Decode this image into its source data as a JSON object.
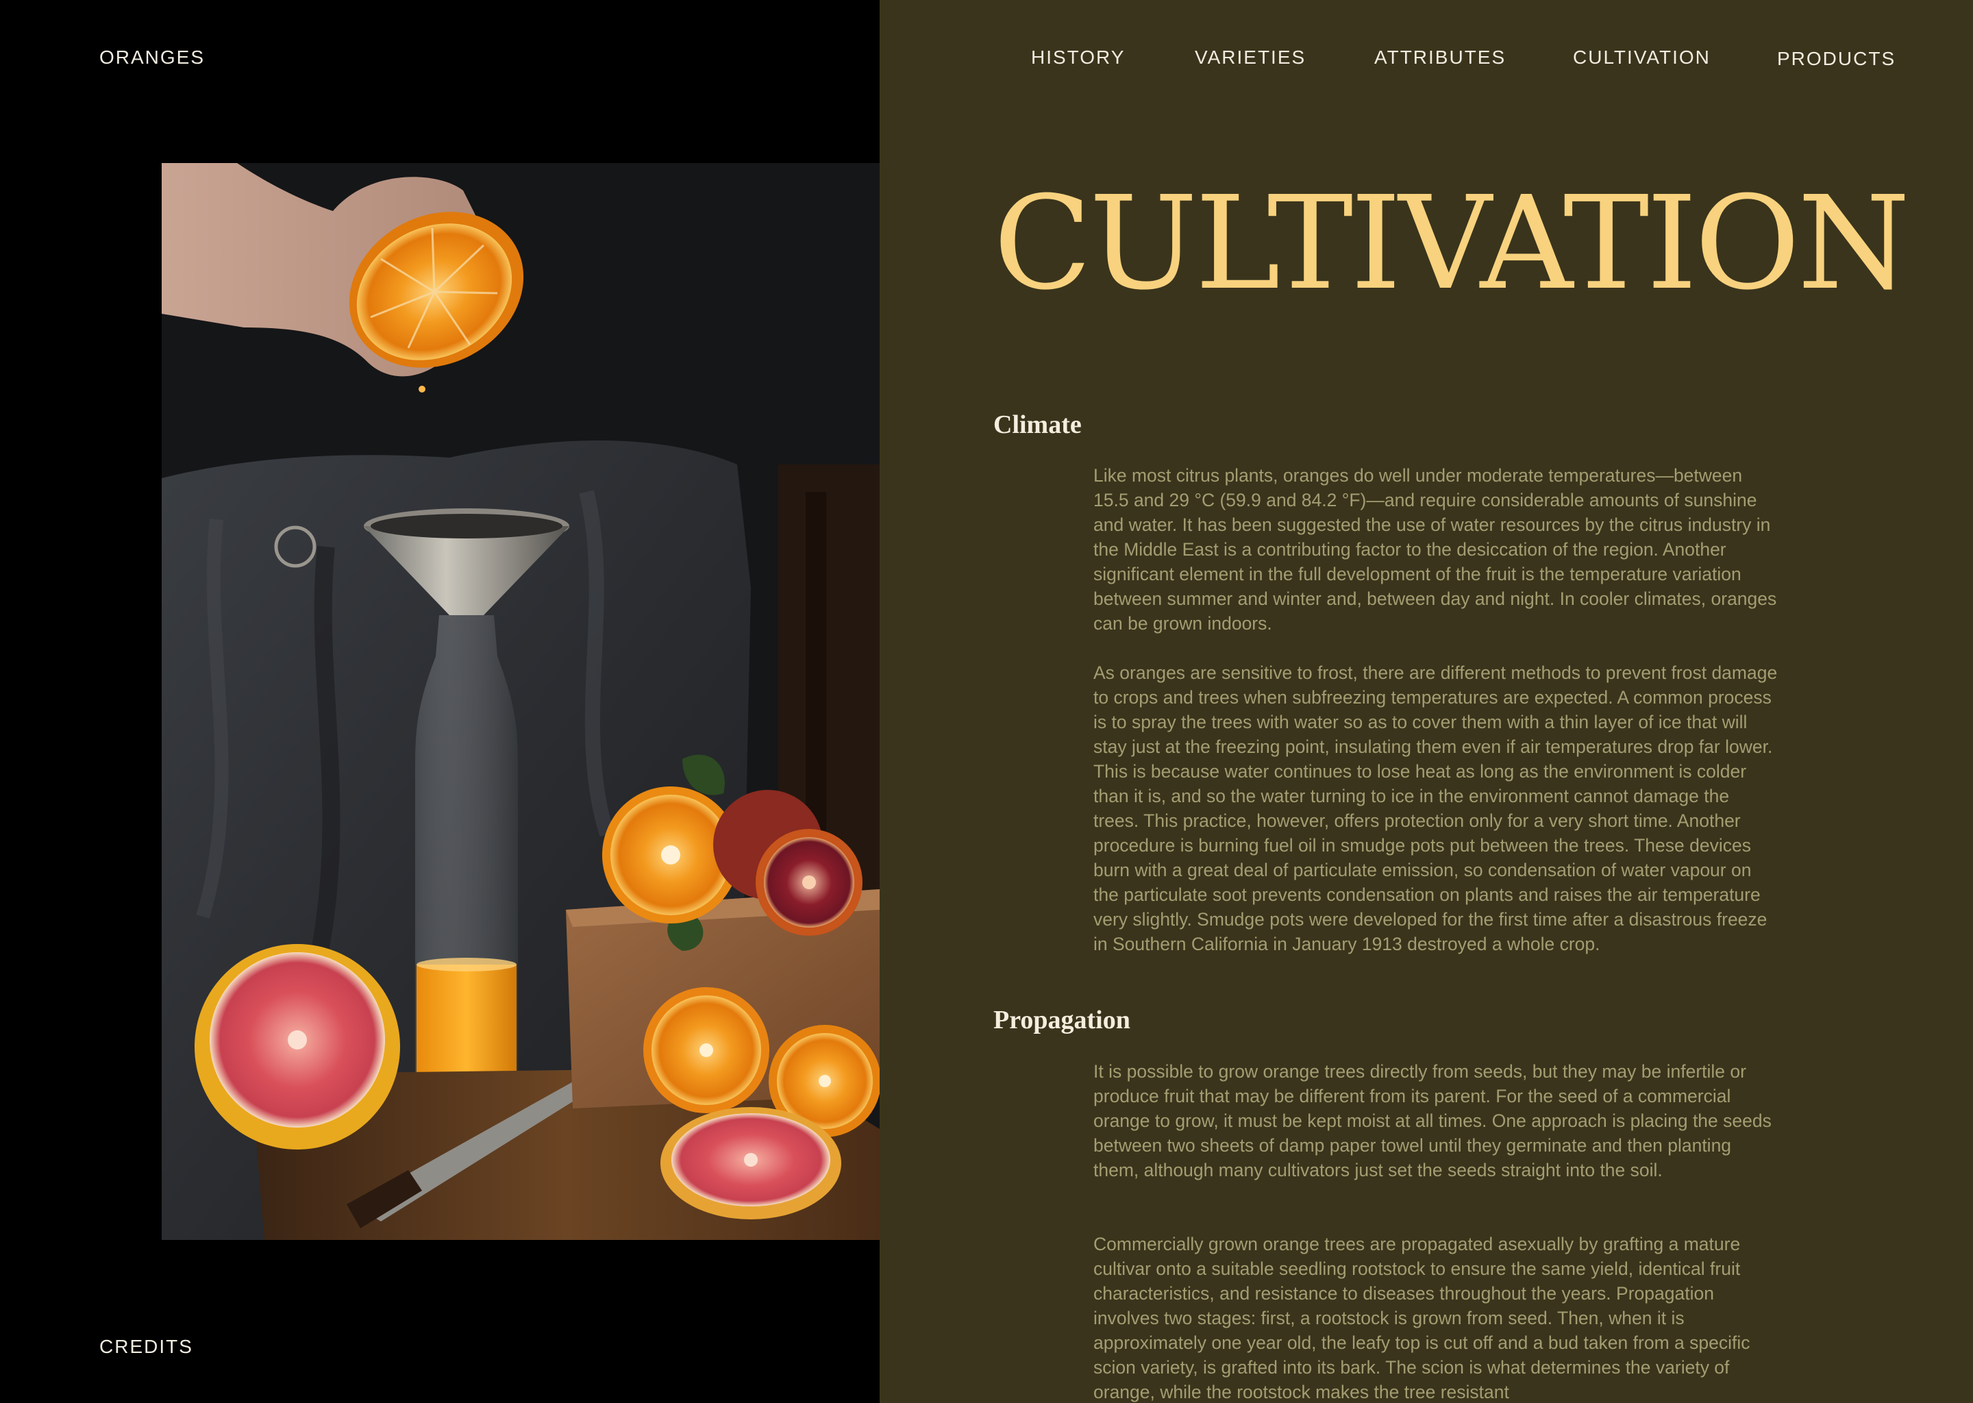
{
  "brand": "ORANGES",
  "credits": "CREDITS",
  "nav": {
    "history": "HISTORY",
    "varieties": "VARIETIES",
    "attributes": "ATTRIBUTES",
    "cultivation": "CULTIVATION",
    "products": "PRODUCTS"
  },
  "title": "CULTIVATION",
  "sections": {
    "climate": {
      "heading": "Climate",
      "p1": "Like most citrus plants, oranges do well under moderate temperatures—between 15.5 and 29 °C (59.9 and 84.2 °F)—and require considerable amounts of sunshine and water. It has been suggested the use of water resources by the citrus industry in the Middle East is a contributing factor to the desiccation of the region. Another significant element in the full development of the fruit is the temperature variation between summer and winter and, between day and night. In cooler climates, oranges can be grown indoors.",
      "p2": "As oranges are sensitive to frost, there are different methods to prevent frost damage to crops and trees when subfreezing temperatures are expected. A common process is to spray the trees with water so as to cover them with a thin layer of ice that will stay just at the freezing point, insulating them even if air temperatures drop far lower. This is because water continues to lose heat as long as the environment is colder than it is, and so the water turning to ice in the environment cannot damage the trees. This practice, however, offers protection only for a very short time. Another procedure is burning fuel oil in smudge pots put between the trees. These devices burn with a great deal of particulate emission, so condensation of water vapour on the particulate soot prevents condensation on plants and raises the air temperature very slightly. Smudge pots were developed for the first time after a disastrous freeze in Southern California in January 1913 destroyed a whole crop."
    },
    "propagation": {
      "heading": "Propagation",
      "p1": "It is possible to grow orange trees directly from seeds, but they may be infertile or produce fruit that may be different from its parent. For the seed of a commercial orange to grow, it must be kept moist at all times. One approach is placing the seeds between two sheets of damp paper towel until they germinate and then planting them, although many cultivators just set the seeds straight into the soil.",
      "p2": "Commercially grown orange trees are propagated asexually by grafting a mature cultivar onto a suitable seedling rootstock to ensure the same yield, identical fruit characteristics, and resistance to diseases throughout the years. Propagation involves two stages: first, a rootstock is grown from seed. Then, when it is approximately one year old, the leafy top is cut off and a bud taken from a specific scion variety, is grafted into its bark. The scion is what determines the variety of orange, while the rootstock makes the tree resistant"
    }
  },
  "colors": {
    "left_background": "#000000",
    "right_background": "#3a341c",
    "title": "#f8d27e",
    "heading": "#f4eedf",
    "body": "#a49d72",
    "nav_text": "#f1ece0"
  },
  "icons": {
    "photo": "orange-juice-still-life-photo"
  }
}
